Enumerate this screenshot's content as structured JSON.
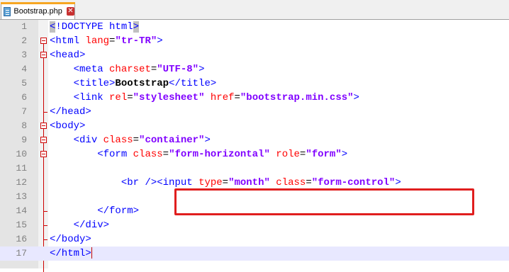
{
  "tab": {
    "filename": "Bootstrap.php",
    "close": "✕"
  },
  "lines": [
    {
      "num": "1",
      "s1": "<",
      "s2": "!DOCTYPE html",
      "s3": ">"
    },
    {
      "num": "2",
      "open": "<html ",
      "attr": "lang",
      "eq": "=",
      "val": "\"tr-TR\"",
      "close": ">"
    },
    {
      "num": "3",
      "text": "<head>"
    },
    {
      "num": "4",
      "indent": "    ",
      "open": "<meta ",
      "attr": "charset",
      "eq": "=",
      "val": "\"UTF-8\"",
      "close": ">"
    },
    {
      "num": "5",
      "indent": "    ",
      "open": "<title>",
      "inner": "Bootstrap",
      "close": "</title>"
    },
    {
      "num": "6",
      "indent": "    ",
      "open": "<link ",
      "attr": "rel",
      "eq": "=",
      "val": "\"stylesheet\"",
      "attr2": " href",
      "eq2": "=",
      "val2": "\"bootstrap.min.css\"",
      "close": ">"
    },
    {
      "num": "7",
      "text": "</head>"
    },
    {
      "num": "8",
      "text": "<body>"
    },
    {
      "num": "9",
      "indent": "    ",
      "open": "<div ",
      "attr": "class",
      "eq": "=",
      "val": "\"container\"",
      "close": ">"
    },
    {
      "num": "10",
      "indent": "        ",
      "open": "<form ",
      "attr": "class",
      "eq": "=",
      "val": "\"form-horizontal\"",
      "attr2": " role",
      "eq2": "=",
      "val2": "\"form\"",
      "close": ">"
    },
    {
      "num": "11"
    },
    {
      "num": "12",
      "indent": "            ",
      "pre": "<br />",
      "open": "<input ",
      "attr": "type",
      "eq": "=",
      "val": "\"month\"",
      "attr2": " class",
      "eq2": "=",
      "val2": "\"form-control\"",
      "close": ">"
    },
    {
      "num": "13"
    },
    {
      "num": "14",
      "indent": "        ",
      "text": "</form>"
    },
    {
      "num": "15",
      "indent": "    ",
      "text": "</div>"
    },
    {
      "num": "16",
      "text": "</body>"
    },
    {
      "num": "17",
      "text": "</html>"
    }
  ]
}
